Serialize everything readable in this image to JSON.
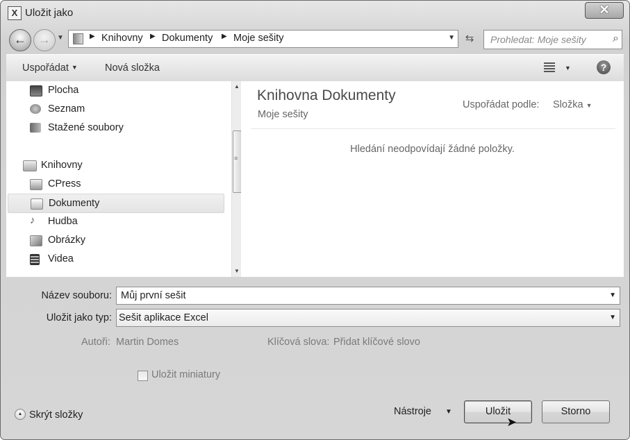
{
  "window": {
    "title": "Uložit jako",
    "close_glyph": "✕"
  },
  "address": {
    "crumbs": [
      "Knihovny",
      "Dokumenty",
      "Moje sešity"
    ],
    "search_placeholder": "Prohledat: Moje sešity"
  },
  "toolbar": {
    "organize_label": "Uspořádat",
    "new_folder_label": "Nová složka",
    "help_glyph": "?"
  },
  "nav_pane": {
    "items": [
      {
        "label": "Plocha",
        "icon": "desktop-icon"
      },
      {
        "label": "Seznam",
        "icon": "recent-places-icon"
      },
      {
        "label": "Stažené soubory",
        "icon": "downloads-icon"
      },
      {
        "label": "Knihovny",
        "icon": "libraries-icon"
      },
      {
        "label": "CPress",
        "icon": "library-icon"
      },
      {
        "label": "Dokumenty",
        "icon": "documents-icon",
        "selected": true
      },
      {
        "label": "Hudba",
        "icon": "music-icon"
      },
      {
        "label": "Obrázky",
        "icon": "pictures-icon"
      },
      {
        "label": "Videa",
        "icon": "videos-icon"
      }
    ]
  },
  "content": {
    "library_title": "Knihovna Dokumenty",
    "library_subtitle": "Moje sešity",
    "arrange_by_label": "Uspořádat podle:",
    "arrange_by_value": "Složka",
    "empty_message": "Hledání neodpovídají žádné položky."
  },
  "form": {
    "filename_label": "Název souboru:",
    "filename_value": "Můj první sešit",
    "filetype_label": "Uložit jako typ:",
    "filetype_value": "Sešit aplikace Excel",
    "authors_label": "Autoři:",
    "authors_value": "Martin Domes",
    "keywords_label": "Klíčová slova:",
    "keywords_value": "Přidat klíčové slovo",
    "thumbnails_label": "Uložit miniatury",
    "thumbnails_checked": false
  },
  "footer": {
    "hide_folders_label": "Skrýt složky",
    "tools_label": "Nástroje",
    "save_label": "Uložit",
    "cancel_label": "Storno"
  }
}
